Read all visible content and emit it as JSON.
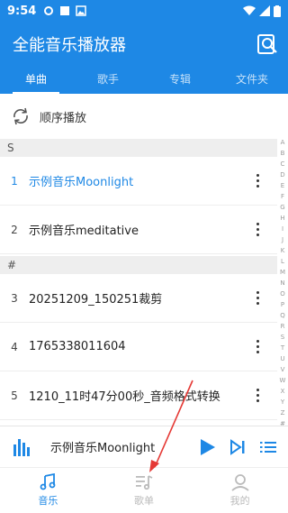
{
  "status_bar": {
    "time": "9:54"
  },
  "app": {
    "title": "全能音乐播放器"
  },
  "tabs": [
    {
      "label": "单曲",
      "active": true
    },
    {
      "label": "歌手",
      "active": false
    },
    {
      "label": "专辑",
      "active": false
    },
    {
      "label": "文件夹",
      "active": false
    }
  ],
  "play_mode": {
    "label": "顺序播放",
    "icon": "repeat-icon"
  },
  "sections": [
    {
      "letter": "S",
      "songs": [
        {
          "number": "1",
          "title": "示例音乐Moonlight",
          "playing": true
        },
        {
          "number": "2",
          "title": "示例音乐meditative",
          "playing": false
        }
      ]
    },
    {
      "letter": "#",
      "songs": [
        {
          "number": "3",
          "title": "20251209_150251裁剪",
          "playing": false
        },
        {
          "number": "4",
          "title": "1765338011604",
          "playing": false
        },
        {
          "number": "5",
          "title": "1210_11时47分00秒_音频格式转换",
          "playing": false
        }
      ]
    }
  ],
  "alpha_index": [
    "A",
    "B",
    "C",
    "D",
    "E",
    "F",
    "G",
    "H",
    "I",
    "J",
    "K",
    "L",
    "M",
    "N",
    "O",
    "P",
    "Q",
    "R",
    "S",
    "T",
    "U",
    "V",
    "W",
    "X",
    "Y",
    "Z",
    "#"
  ],
  "player": {
    "now_playing": "示例音乐Moonlight"
  },
  "bottom_nav": [
    {
      "label": "音乐",
      "icon": "music-note-icon",
      "active": true
    },
    {
      "label": "歌单",
      "icon": "playlist-icon",
      "active": false
    },
    {
      "label": "我的",
      "icon": "profile-icon",
      "active": false
    }
  ],
  "colors": {
    "accent": "#1e88e5",
    "section_bg": "#eeeeee",
    "annotation": "#e53935"
  }
}
